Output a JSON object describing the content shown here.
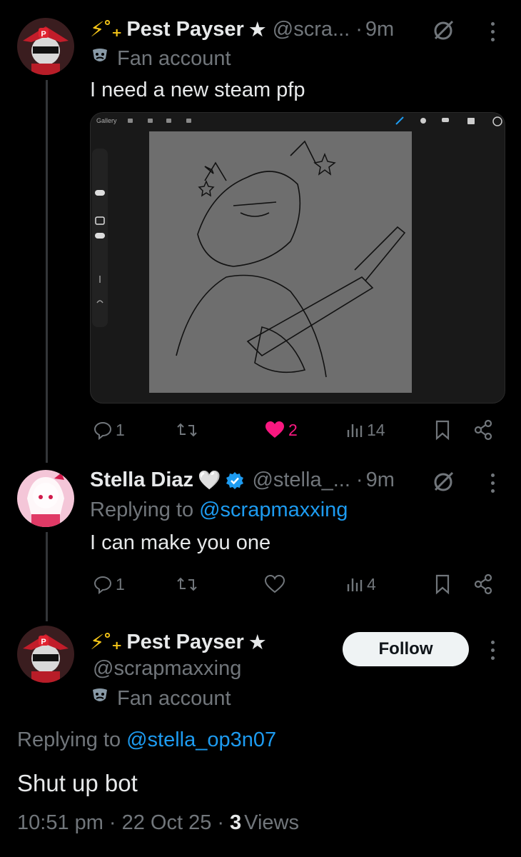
{
  "post1": {
    "name_prefix": "⚡˚₊",
    "name": "Pest Payser",
    "name_star": "★",
    "handle": "@scra...",
    "time_sep": "·",
    "time": "9m",
    "badge_label": "Fan account",
    "text": "I need a new steam pfp",
    "image_toolbar_label": "Gallery",
    "actions": {
      "replies": "1",
      "likes": "2",
      "views": "14"
    }
  },
  "post2": {
    "name": "Stella Diaz",
    "heart": "🤍",
    "handle": "@stella_...",
    "time_sep": "·",
    "time": "9m",
    "replying_prefix": "Replying to",
    "replying_handle": "@scrapmaxxing",
    "text": "I can make you one",
    "actions": {
      "replies": "1",
      "likes": "",
      "views": "4"
    }
  },
  "post3": {
    "name_prefix": "⚡˚₊",
    "name": "Pest Payser",
    "name_star": "★",
    "handle": "@scrapmaxxing",
    "badge_label": "Fan account",
    "follow_label": "Follow",
    "replying_prefix": "Replying to",
    "replying_handle": "@stella_op3n07",
    "text": "Shut up bot",
    "footer_time": "10:51 pm",
    "footer_sep1": "·",
    "footer_date": "22 Oct 25",
    "footer_sep2": "·",
    "footer_views_count": "3",
    "footer_views_label": "Views"
  },
  "colors": {
    "like": "#f91880",
    "link": "#1d9bf0",
    "verified": "#1d9bf0",
    "muted": "#71767b"
  }
}
